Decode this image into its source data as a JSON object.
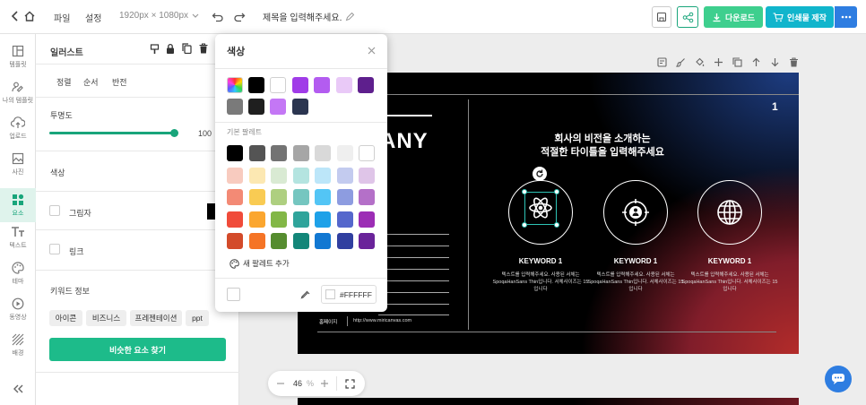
{
  "topbar": {
    "file": "파일",
    "settings": "설정",
    "size": "1920px × 1080px",
    "title_placeholder": "제목을 입력해주세요.",
    "download": "다운로드",
    "print_order": "인쇄물 제작"
  },
  "leftnav": [
    {
      "label": "템플릿",
      "icon": "template-icon"
    },
    {
      "label": "나의 템플릿",
      "icon": "my-template-icon"
    },
    {
      "label": "업로드",
      "icon": "upload-icon"
    },
    {
      "label": "사진",
      "icon": "photo-icon"
    },
    {
      "label": "요소",
      "icon": "elements-icon",
      "active": true
    },
    {
      "label": "텍스트",
      "icon": "text-icon"
    },
    {
      "label": "테마",
      "icon": "palette-icon"
    },
    {
      "label": "동영상",
      "icon": "video-icon"
    },
    {
      "label": "배경",
      "icon": "background-icon"
    }
  ],
  "panel": {
    "title": "일러스트",
    "tabs": [
      "정렬",
      "순서",
      "반전"
    ],
    "opacity_label": "투명도",
    "opacity_value": "100",
    "opacity_percent": 100,
    "color_label": "색상",
    "shadow_label": "그림자",
    "link_label": "링크",
    "keyword_label": "키워드 정보",
    "keywords": [
      "아이콘",
      "비즈니스",
      "프레젠테이션",
      "ppt"
    ],
    "find_similar": "비슷한 요소 찾기"
  },
  "popup": {
    "title": "색상",
    "recent_colors": [
      "#000000",
      "#ffffff",
      "#a03ce8",
      "#b35cf0",
      "#e9c9f7",
      "#5e1f8d",
      "#7a7a7a",
      "#1f1f1f",
      "#c477f5",
      "#2b3550"
    ],
    "palette_label": "기본 팔레트",
    "palette": [
      [
        "#000000",
        "#545454",
        "#737373",
        "#a6a6a6",
        "#d9d9d9",
        "#efefef",
        "#ffffff"
      ],
      [
        "#f8cbbf",
        "#fce8b2",
        "#d9ead3",
        "#b4e4e0",
        "#bce6f9",
        "#c3cbef",
        "#dfc5e8"
      ],
      [
        "#f38a75",
        "#f9cb53",
        "#aecf80",
        "#75c6c0",
        "#53c5f5",
        "#8d9ce0",
        "#b470c8"
      ],
      [
        "#f04b3a",
        "#fba62f",
        "#82b746",
        "#2fa49b",
        "#1ea1e8",
        "#5567cc",
        "#9c2db5"
      ],
      [
        "#d34b2a",
        "#f57426",
        "#558c2f",
        "#138679",
        "#1278d2",
        "#303fa0",
        "#6a239a"
      ]
    ],
    "add_palette": "새 팔레트 추가",
    "hex_value": "#FFFFFF"
  },
  "canvas": {
    "page_number": "1",
    "company_fragment": "ANY",
    "headline_1": "회사의 비전을 소개하는",
    "headline_2": "적절한 타이틀을 입력해주세요",
    "keywords": [
      {
        "title": "KEYWORD 1",
        "icon": "atom-icon",
        "desc": "텍스트를 입력해주세요. 사용된 서체는 SpoqaHanSans Thin입니다. 서체사이즈는 15입니다"
      },
      {
        "title": "KEYWORD 1",
        "icon": "teamwork-icon",
        "desc": "텍스트를 입력해주세요. 사용된 서체는 SpoqaHanSans Thin입니다. 서체사이즈는 15입니다"
      },
      {
        "title": "KEYWORD 1",
        "icon": "globe-icon",
        "desc": "텍스트를 입력해주세요. 사용된 서체는 SpoqaHanSans Thin입니다. 서체사이즈는 15입니다"
      }
    ],
    "homepage_label": "홈페이지",
    "homepage_url": "http://www.miricanvas.com"
  },
  "zoom": {
    "value": "46",
    "unit": "%"
  },
  "colors": {
    "accent": "#19a57b",
    "download_btn": "#3ecf8e",
    "print_btn": "#11b5cc",
    "more_btn": "#2e7de1"
  }
}
